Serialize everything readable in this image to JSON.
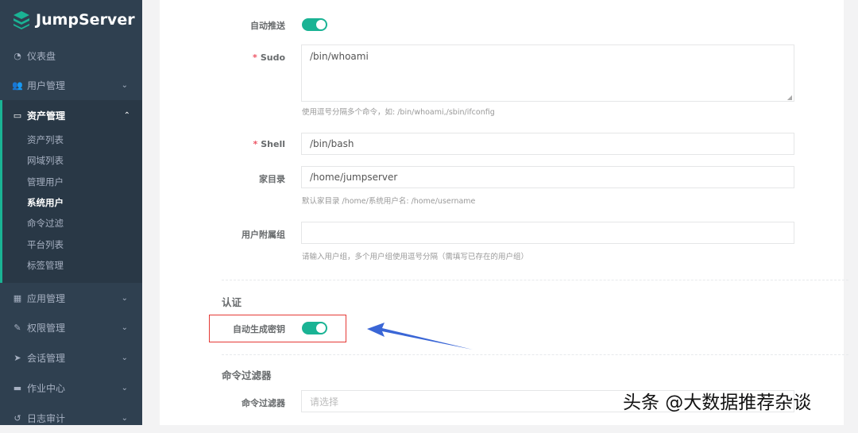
{
  "app": {
    "name": "JumpServer"
  },
  "sidebar": {
    "items": [
      {
        "label": "仪表盘",
        "icon": "dashboard-icon"
      },
      {
        "label": "用户管理",
        "icon": "users-icon"
      },
      {
        "label": "资产管理",
        "icon": "inbox-icon"
      },
      {
        "label": "应用管理",
        "icon": "grid-icon"
      },
      {
        "label": "权限管理",
        "icon": "edit-icon"
      },
      {
        "label": "会话管理",
        "icon": "rocket-icon"
      },
      {
        "label": "作业中心",
        "icon": "coffee-icon"
      },
      {
        "label": "日志审计",
        "icon": "history-icon"
      }
    ],
    "submenu": [
      "资产列表",
      "网域列表",
      "管理用户",
      "系统用户",
      "命令过滤",
      "平台列表",
      "标签管理"
    ],
    "active_submenu": "系统用户"
  },
  "form": {
    "auto_push_label": "自动推送",
    "auto_push_on": true,
    "sudo_label": "Sudo",
    "sudo_value": "/bin/whoami",
    "sudo_help": "使用逗号分隔多个命令，如: /bin/whoami,/sbin/ifconfig",
    "shell_label": "Shell",
    "shell_value": "/bin/bash",
    "home_label": "家目录",
    "home_value": "/home/jumpserver",
    "home_help": "默认家目录 /home/系统用户名: /home/username",
    "groups_label": "用户附属组",
    "groups_value": "",
    "groups_help": "请输入用户组，多个用户组使用逗号分隔（需填写已存在的用户组）",
    "auth_section": "认证",
    "auto_key_label": "自动生成密钥",
    "auto_key_on": true,
    "filter_section": "命令过滤器",
    "filter_label": "命令过滤器",
    "filter_placeholder": "请选择"
  },
  "watermark": "头条 @大数据推荐杂谈",
  "colors": {
    "sidebar_bg": "#2f4050",
    "accent": "#1ab394",
    "highlight_box": "#e53935",
    "arrow": "#3a66d6"
  }
}
